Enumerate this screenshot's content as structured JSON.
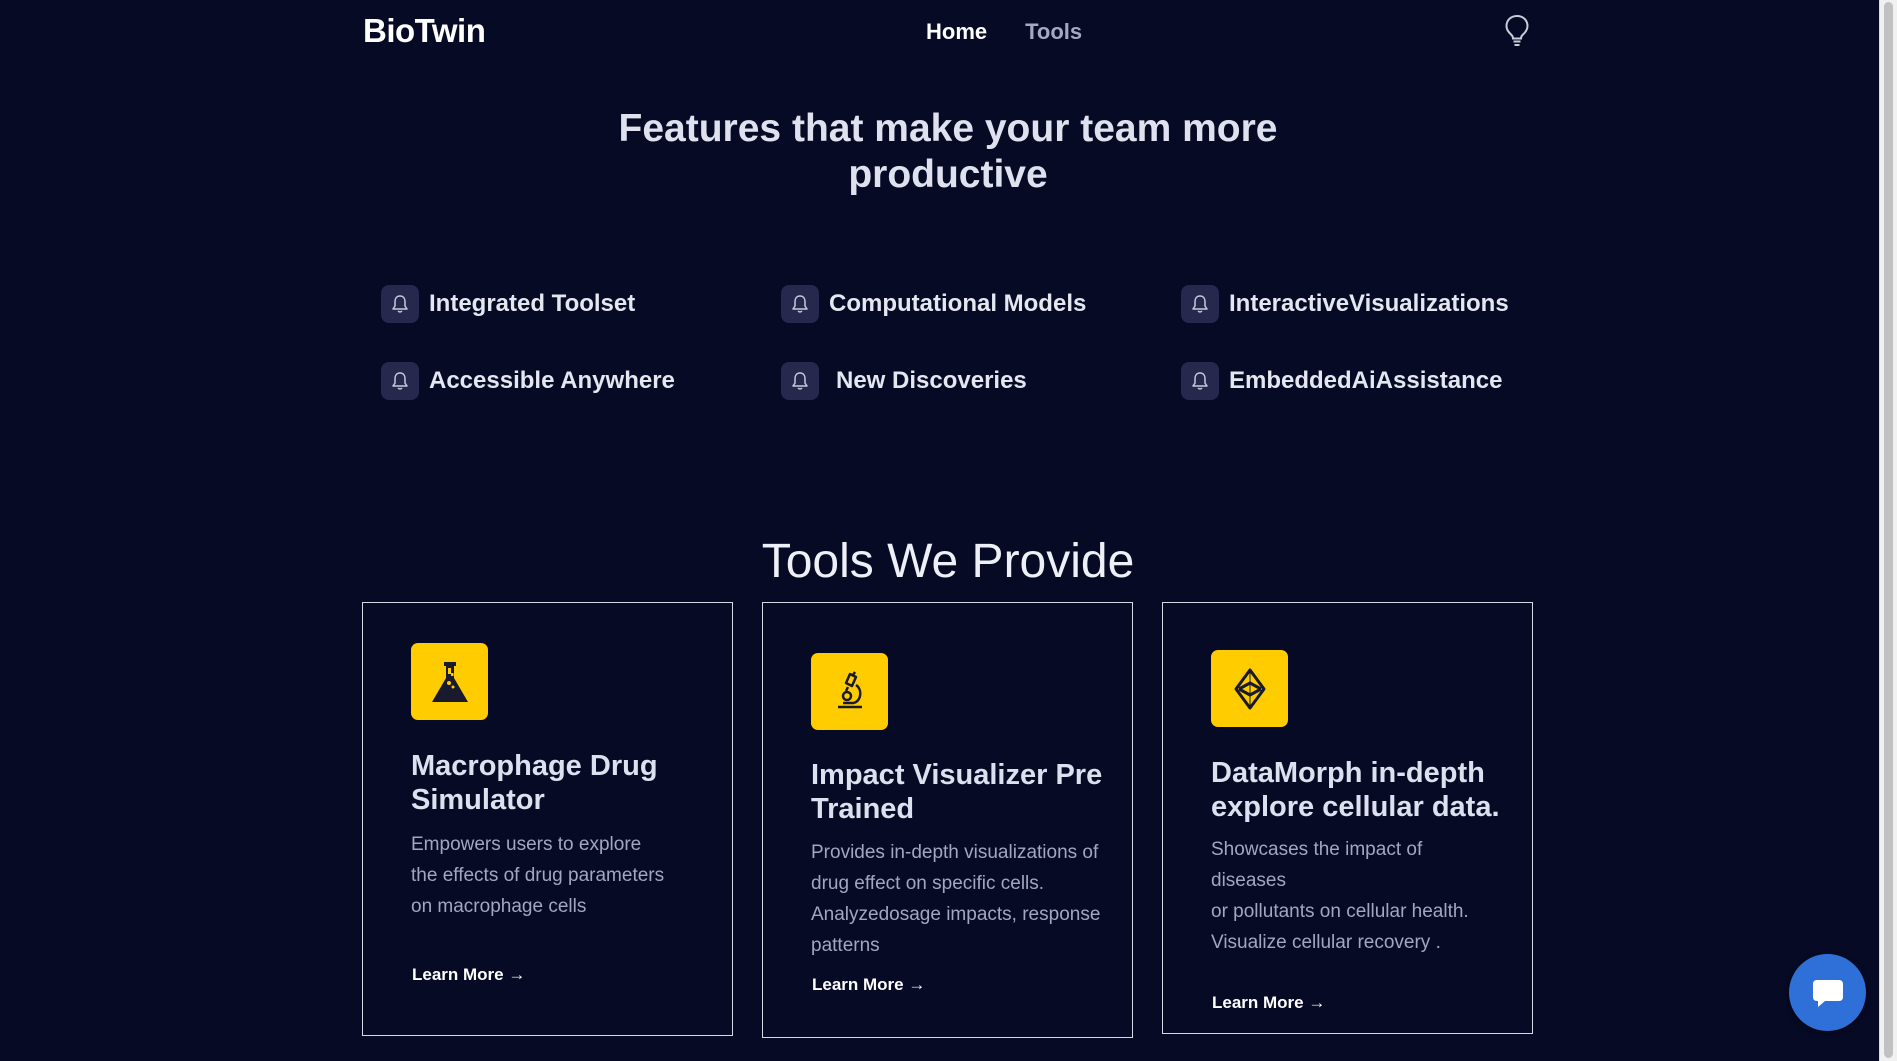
{
  "header": {
    "logo": "BioTwin",
    "nav": [
      {
        "label": "Home",
        "active": true
      },
      {
        "label": "Tools",
        "active": false
      }
    ],
    "theme_icon": "lightbulb-icon"
  },
  "features": {
    "title": "Features that make your team more productive",
    "items": [
      {
        "label": "Integrated Toolset",
        "icon": "bell-icon"
      },
      {
        "label": "Computational Models",
        "icon": "bell-icon"
      },
      {
        "label": "InteractiveVisualizations",
        "icon": "bell-icon"
      },
      {
        "label": "Accessible Anywhere",
        "icon": "bell-icon"
      },
      {
        "label": "New Discoveries",
        "icon": "bell-icon"
      },
      {
        "label": "EmbeddedAiAssistance",
        "icon": "bell-icon"
      }
    ]
  },
  "tools": {
    "title": "Tools We Provide",
    "cards": [
      {
        "title": "Macrophage Drug Simulator",
        "description": "Empowers users to explore\nthe effects of drug parameters\non macrophage cells",
        "link": "Learn More →",
        "icon": "flask-icon"
      },
      {
        "title": "Impact Visualizer Pre Trained",
        "description": "Provides in-depth visualizations of\ndrug effect on specific cells.\nAnalyzedosage impacts, response\n patterns",
        "link": "Learn More →",
        "icon": "microscope-icon"
      },
      {
        "title": "DataMorph in-depth explore cellular data.",
        "description": "Showcases the impact of\ndiseases\nor pollutants on cellular health.\nVisualize cellular recovery .",
        "link": "Learn More →",
        "icon": "ethereum-icon"
      }
    ]
  },
  "chat": {
    "icon": "chat-bubble-icon"
  },
  "colors": {
    "background": "#060a24",
    "accent": "#ffcc00",
    "chat_button": "#2f6fd8",
    "feature_icon_bg": "#26294d"
  }
}
